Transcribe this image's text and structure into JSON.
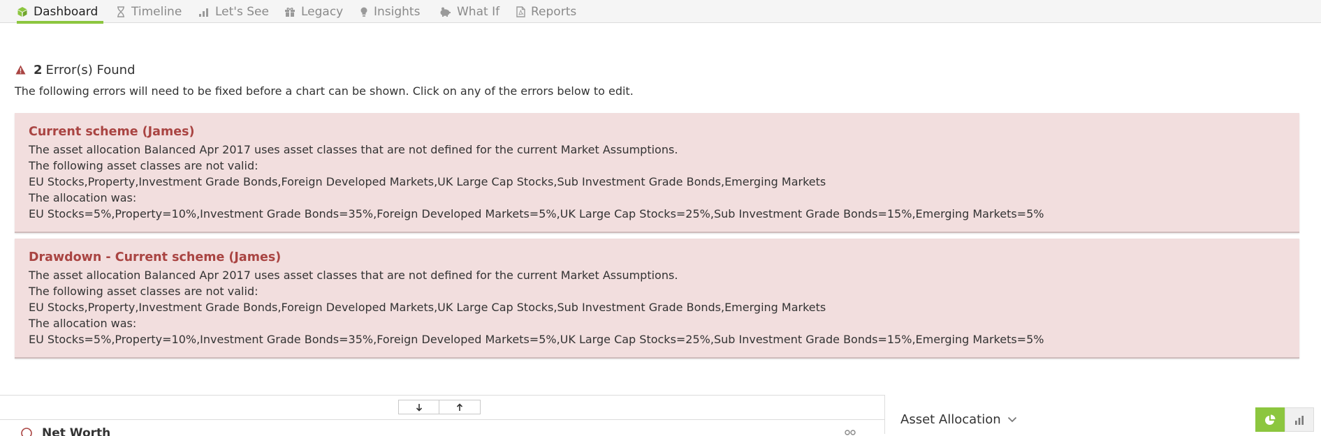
{
  "nav": {
    "tabs": [
      {
        "label": "Dashboard",
        "icon": "cube-icon",
        "active": true
      },
      {
        "label": "Timeline",
        "icon": "hourglass-icon",
        "active": false
      },
      {
        "label": "Let's See",
        "icon": "bar-chart-icon",
        "active": false
      },
      {
        "label": "Legacy",
        "icon": "gift-icon",
        "active": false
      },
      {
        "label": "Insights",
        "icon": "lightbulb-icon",
        "active": false
      },
      {
        "label": "What If",
        "icon": "piggy-bank-icon",
        "active": false
      },
      {
        "label": "Reports",
        "icon": "pdf-file-icon",
        "active": false
      }
    ]
  },
  "errors": {
    "count": "2",
    "title": "Error(s) Found",
    "description": "The following errors will need to be fixed before a chart can be shown. Click on any of the errors below to edit.",
    "items": [
      {
        "title": "Current scheme (James)",
        "lines": [
          "The asset allocation Balanced Apr 2017 uses asset classes that are not defined for the current Market Assumptions.",
          "The following asset classes are not valid:",
          "EU Stocks,Property,Investment Grade Bonds,Foreign Developed Markets,UK Large Cap Stocks,Sub Investment Grade Bonds,Emerging Markets",
          "The allocation was:",
          "EU Stocks=5%,Property=10%,Investment Grade Bonds=35%,Foreign Developed Markets=5%,UK Large Cap Stocks=25%,Sub Investment Grade Bonds=15%,Emerging Markets=5%"
        ]
      },
      {
        "title": "Drawdown - Current scheme (James)",
        "lines": [
          "The asset allocation Balanced Apr 2017 uses asset classes that are not defined for the current Market Assumptions.",
          "The following asset classes are not valid:",
          "EU Stocks,Property,Investment Grade Bonds,Foreign Developed Markets,UK Large Cap Stocks,Sub Investment Grade Bonds,Emerging Markets",
          "The allocation was:",
          "EU Stocks=5%,Property=10%,Investment Grade Bonds=35%,Foreign Developed Markets=5%,UK Large Cap Stocks=25%,Sub Investment Grade Bonds=15%,Emerging Markets=5%"
        ]
      }
    ]
  },
  "bottom": {
    "left_panel_title": "Net Worth",
    "asset_allocation_title": "Asset Allocation"
  },
  "colors": {
    "accent_green": "#8cc63f",
    "error_background": "#f2dede",
    "error_title": "#a94442",
    "warning_icon": "#a94442"
  }
}
